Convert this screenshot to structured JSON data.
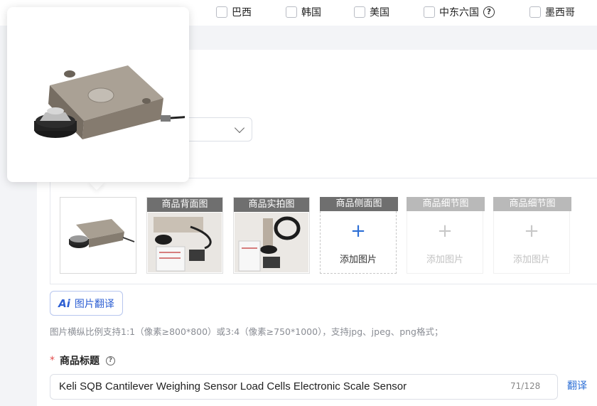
{
  "countries": [
    {
      "label": "巴西"
    },
    {
      "label": "韩国"
    },
    {
      "label": "美国"
    },
    {
      "label": "中东六国"
    },
    {
      "label": "墨西哥"
    }
  ],
  "image_slots": [
    {
      "header": "",
      "kind": "filled-main"
    },
    {
      "header": "商品背面图",
      "kind": "filled"
    },
    {
      "header": "商品实拍图",
      "kind": "filled"
    },
    {
      "header": "商品侧面图",
      "kind": "add",
      "add_label": "添加图片"
    },
    {
      "header": "商品细节图",
      "kind": "add-disabled",
      "add_label": "添加图片"
    },
    {
      "header": "商品细节图",
      "kind": "add-disabled",
      "add_label": "添加图片"
    }
  ],
  "translate_button": {
    "icon": "Ai",
    "label": "图片翻译"
  },
  "hint": "图片横纵比例支持1:1（像素≥800*800）或3:4（像素≥750*1000），支持jpg、jpeg、png格式；",
  "title_field": {
    "label": "商品标题",
    "value": "Keli SQB  Cantilever Weighing Sensor Load Cells Electronic Scale Sensor",
    "counter": "71/128",
    "translate_link": "翻译"
  },
  "colors": {
    "accent": "#2d5fd3",
    "required": "#e34d4d"
  }
}
